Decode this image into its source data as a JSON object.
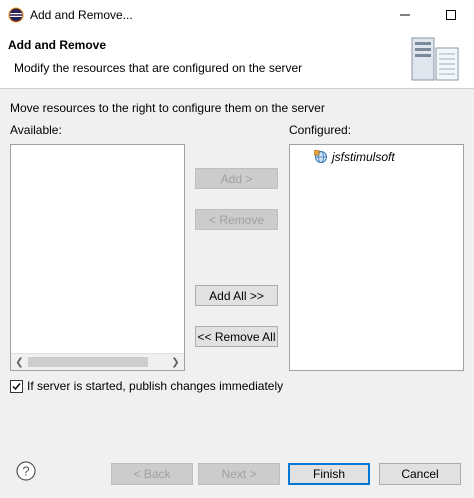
{
  "window": {
    "title": "Add and Remove..."
  },
  "header": {
    "title": "Add and Remove",
    "description": "Modify the resources that are configured on the server"
  },
  "content": {
    "instruction": "Move resources to the right to configure them on the server",
    "available_label": "Available:",
    "configured_label": "Configured:",
    "available_items": [],
    "configured_items": [
      {
        "name": "jsfstimulsoft",
        "icon": "web-module-icon"
      }
    ]
  },
  "buttons": {
    "add": "Add >",
    "remove": "< Remove",
    "add_all": "Add All >>",
    "remove_all": "<< Remove All"
  },
  "publish": {
    "label": "If server is started, publish changes immediately",
    "checked": true
  },
  "footer": {
    "back": "< Back",
    "next": "Next >",
    "finish": "Finish",
    "cancel": "Cancel"
  },
  "colors": {
    "accent": "#0078d7",
    "panel": "#f0f0f0",
    "disabled_text": "#a0a0a0"
  }
}
